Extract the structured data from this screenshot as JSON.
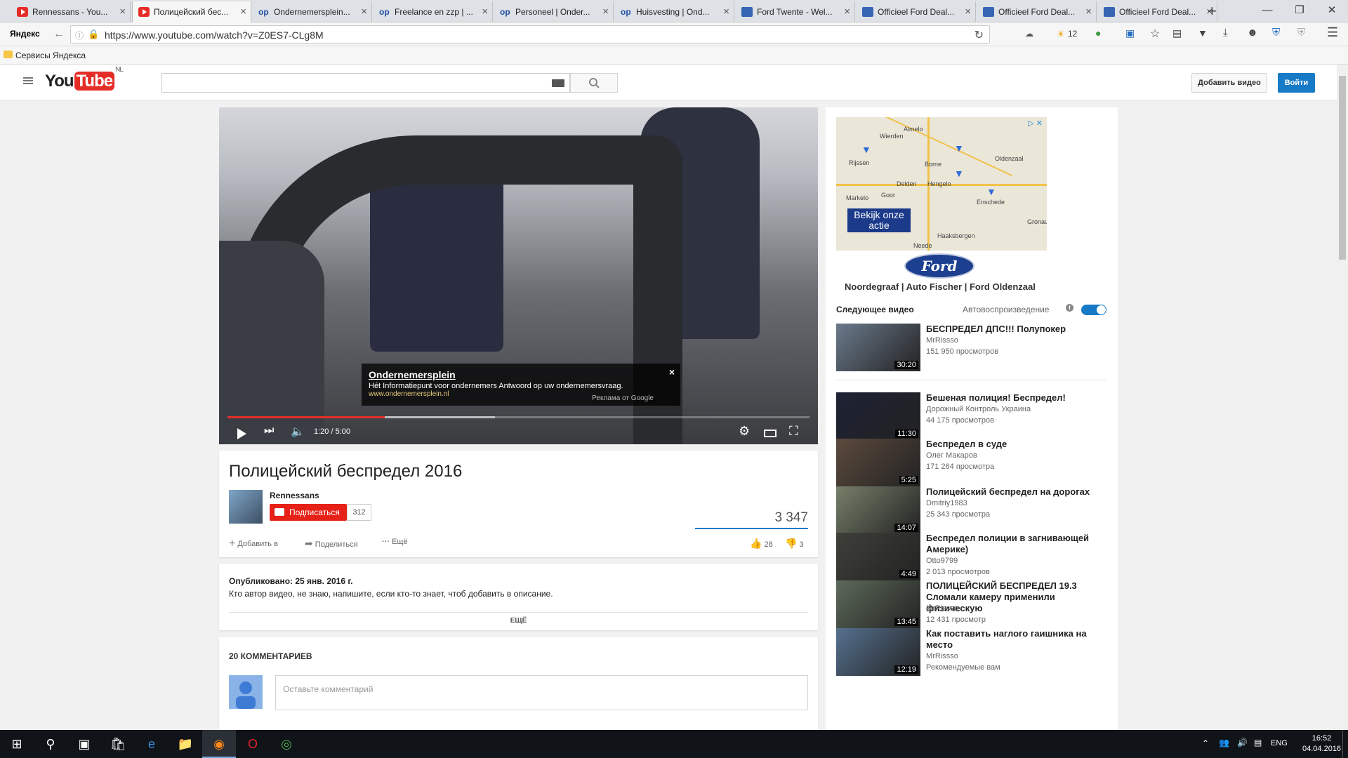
{
  "browser": {
    "tabs": [
      {
        "label": "Rennessans - You...",
        "icon": "youtube-icon"
      },
      {
        "label": "Полицейский бес...",
        "icon": "youtube-icon"
      },
      {
        "label": "Ondernemersplein...",
        "icon": "op-icon"
      },
      {
        "label": "Freelance en zzp | ...",
        "icon": "op-icon"
      },
      {
        "label": "Personeel | Onder...",
        "icon": "op-icon"
      },
      {
        "label": "Huisvesting | Ond...",
        "icon": "op-icon"
      },
      {
        "label": "Ford Twente - Wel...",
        "icon": "ford-icon"
      },
      {
        "label": "Officieel Ford Deal...",
        "icon": "ford-icon"
      },
      {
        "label": "Officieel Ford Deal...",
        "icon": "ford-icon"
      },
      {
        "label": "Officieel Ford Deal...",
        "icon": "ford-icon"
      }
    ],
    "active_tab": 1,
    "new_tab": "+",
    "yandex_logo": "Яндекс",
    "url": "https://www.youtube.com/watch?v=Z0ES7-CLg8M",
    "badge_count": "12",
    "bookmark": "Сервисы Яндекса"
  },
  "youtube": {
    "logo_you": "You",
    "logo_tube": "Tube",
    "region": "NL",
    "search_placeholder": "",
    "add_video": "Добавить видео",
    "sign_in": "Войти"
  },
  "player": {
    "ad": {
      "title": "Ondernemersplein",
      "description": "Hét Informatiepunt voor ondernemers Antwoord op uw ondernemersvraag.",
      "url": "www.ondernemersplein.nl",
      "attribution": "Реклама от Google",
      "close": "×"
    },
    "time": "1:20 / 5:00",
    "progress_fraction": 0.27,
    "buffer_fraction": 0.46
  },
  "video": {
    "title": "Полицейский беспредел 2016",
    "channel": "Rennessans",
    "subscribe_label": "Подписаться",
    "subscriber_count": "312",
    "views": "3 347",
    "add_to": "Добавить в",
    "share": "Поделиться",
    "more": "Ещё",
    "likes": "28",
    "dislikes": "3",
    "published": "Опубликовано: 25 янв. 2016 г.",
    "description": "Кто автор видео, не знаю, напишите, если кто-то знает, чтоб добавить в описание.",
    "show_more": "ЕЩЁ"
  },
  "comments": {
    "count_label": "20 КОММЕНТАРИЕВ",
    "placeholder": "Оставьте комментарий"
  },
  "sidebar": {
    "ad": {
      "cta": "Bekijk onze actie",
      "brand": "Ford",
      "dealers": "Noordegraaf | Auto Fischer | Ford Oldenzaal",
      "towns": [
        "Almelo",
        "Rijssen",
        "Oldenzaal",
        "Borne",
        "Hengelo",
        "Enschede",
        "Haaksbergen",
        "Gronau",
        "Markelo",
        "Goor",
        "Delden",
        "Wierden",
        "Neede"
      ]
    },
    "next_label": "Следующее видео",
    "autoplay_label": "Автовоспроизведение",
    "recommendations": [
      {
        "title": "БЕСПРЕДЕЛ ДПС!!! Полупокер",
        "channel": "MrRissso",
        "views": "151 950 просмотров",
        "duration": "30:20",
        "color": "#6b7a8c"
      },
      {
        "title": "Бешеная полиция! Беспредел!",
        "channel": "Дорожный Контроль Украина",
        "views": "44 175 просмотров",
        "duration": "11:30",
        "color": "#1d2234"
      },
      {
        "title": "Беспредел в суде",
        "channel": "Олег Макаров",
        "views": "171 264 просмотра",
        "duration": "5:25",
        "color": "#5c4a3d"
      },
      {
        "title": "Полицейский беспредел на дорогах",
        "channel": "Dmitriy1983",
        "views": "25 343 просмотра",
        "duration": "14:07",
        "color": "#77806a"
      },
      {
        "title": "Беспредел полиции в загнивающей Америке)",
        "channel": "Otto9799",
        "views": "2 013 просмотров",
        "duration": "4:49",
        "color": "#3f3f3a"
      },
      {
        "title": "ПОЛИЦЕЙСКИЙ БЕСПРЕДЕЛ 19.3 Сломали камеру применили физическую",
        "channel": "MrRissso",
        "views": "12 431 просмотр",
        "duration": "13:45",
        "color": "#5d6a5a"
      },
      {
        "title": "Как поставить наглого гаишника на место",
        "channel": "MrRissso",
        "views": "Рекомендуемые вам",
        "duration": "12:19",
        "color": "#56718f"
      }
    ]
  },
  "taskbar": {
    "lang": "ENG",
    "time": "16:52",
    "date": "04.04.2016"
  }
}
